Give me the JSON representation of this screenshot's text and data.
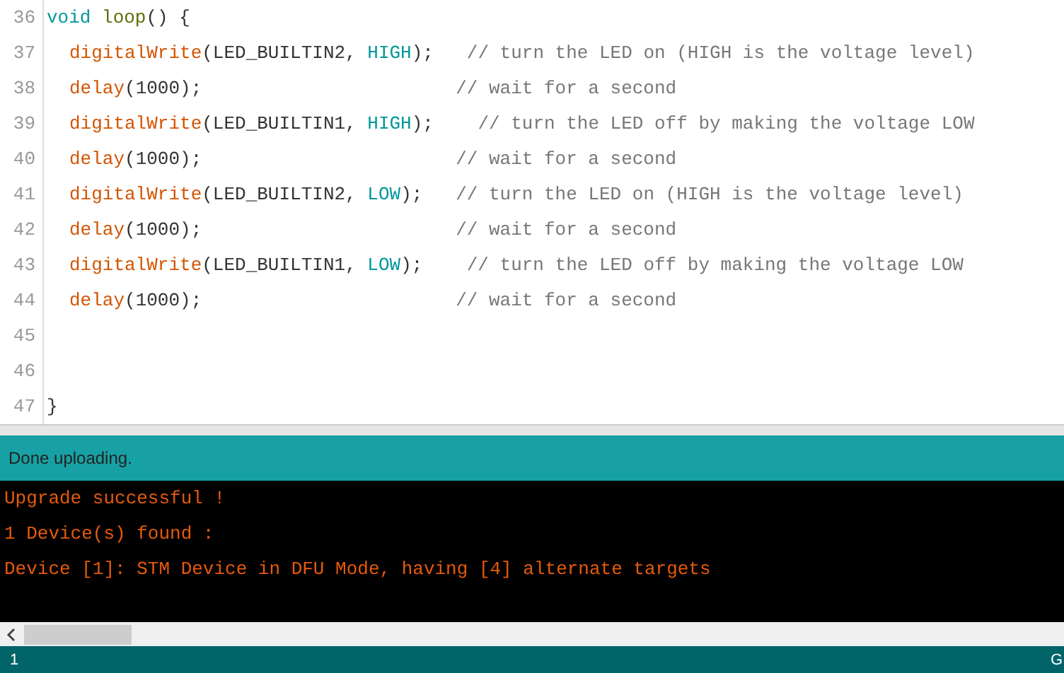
{
  "editor": {
    "lines": [
      {
        "number": "36",
        "tokens": [
          {
            "kind": "keyword",
            "text": "void "
          },
          {
            "kind": "name",
            "text": "loop"
          },
          {
            "kind": "plain",
            "text": "() {"
          }
        ],
        "children": [
          {
            "number": "37",
            "tokens": [
              {
                "kind": "func",
                "text": "digitalWrite"
              },
              {
                "kind": "plain",
                "text": "(LED_BUILTIN2, "
              },
              {
                "kind": "keyword",
                "text": "HIGH"
              },
              {
                "kind": "plain",
                "text": ");   "
              },
              {
                "kind": "comment",
                "text": "// turn the LED on (HIGH is the voltage level)"
              }
            ]
          },
          {
            "number": "38",
            "tokens": [
              {
                "kind": "func",
                "text": "delay"
              },
              {
                "kind": "plain",
                "text": "(1000);                       "
              },
              {
                "kind": "comment",
                "text": "// wait for a second"
              }
            ]
          },
          {
            "number": "39",
            "tokens": [
              {
                "kind": "func",
                "text": "digitalWrite"
              },
              {
                "kind": "plain",
                "text": "(LED_BUILTIN1, "
              },
              {
                "kind": "keyword",
                "text": "HIGH"
              },
              {
                "kind": "plain",
                "text": ");    "
              },
              {
                "kind": "comment",
                "text": "// turn the LED off by making the voltage LOW"
              }
            ]
          },
          {
            "number": "40",
            "tokens": [
              {
                "kind": "func",
                "text": "delay"
              },
              {
                "kind": "plain",
                "text": "(1000);                       "
              },
              {
                "kind": "comment",
                "text": "// wait for a second"
              }
            ]
          },
          {
            "number": "41",
            "tokens": [
              {
                "kind": "func",
                "text": "digitalWrite"
              },
              {
                "kind": "plain",
                "text": "(LED_BUILTIN2, "
              },
              {
                "kind": "keyword",
                "text": "LOW"
              },
              {
                "kind": "plain",
                "text": ");   "
              },
              {
                "kind": "comment",
                "text": "// turn the LED on (HIGH is the voltage level)"
              }
            ]
          },
          {
            "number": "42",
            "tokens": [
              {
                "kind": "func",
                "text": "delay"
              },
              {
                "kind": "plain",
                "text": "(1000);                       "
              },
              {
                "kind": "comment",
                "text": "// wait for a second"
              }
            ]
          },
          {
            "number": "43",
            "tokens": [
              {
                "kind": "func",
                "text": "digitalWrite"
              },
              {
                "kind": "plain",
                "text": "(LED_BUILTIN1, "
              },
              {
                "kind": "keyword",
                "text": "LOW"
              },
              {
                "kind": "plain",
                "text": ");    "
              },
              {
                "kind": "comment",
                "text": "// turn the LED off by making the voltage LOW"
              }
            ]
          },
          {
            "number": "44",
            "tokens": [
              {
                "kind": "func",
                "text": "delay"
              },
              {
                "kind": "plain",
                "text": "(1000);                       "
              },
              {
                "kind": "comment",
                "text": "// wait for a second"
              }
            ]
          },
          {
            "number": "45"
          },
          {
            "number": "46"
          }
        ]
      },
      {
        "number": "47",
        "tokens": [
          {
            "kind": "plain",
            "text": "}"
          }
        ]
      }
    ]
  },
  "status": {
    "message": "Done uploading."
  },
  "console": {
    "lines": [
      "Upgrade successful !",
      "1 Device(s) found :",
      "Device [1]: STM Device in DFU Mode, having [4] alternate targets"
    ]
  },
  "status_bar": {
    "line_number": "1",
    "right_text": "G"
  }
}
